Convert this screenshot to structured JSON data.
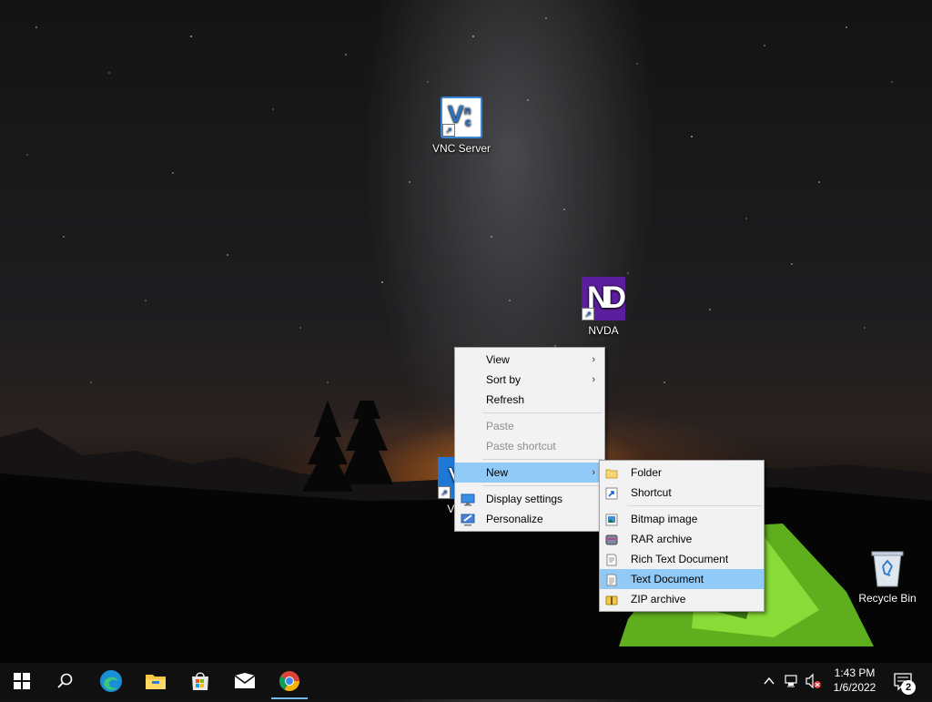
{
  "desktop": {
    "icons": {
      "vnc_server": {
        "label": "VNC Server",
        "icon": "vnc-icon"
      },
      "nvda": {
        "label": "NVDA",
        "icon": "nvda-icon"
      },
      "vnc_viewer": {
        "label": "VNC",
        "icon": "vnc-icon"
      },
      "recycle_bin": {
        "label": "Recycle Bin",
        "icon": "recycle-bin-icon"
      }
    }
  },
  "context_menu": {
    "view": "View",
    "sort_by": "Sort by",
    "refresh": "Refresh",
    "paste": "Paste",
    "paste_shortcut": "Paste shortcut",
    "new": "New",
    "display_settings": "Display settings",
    "personalize": "Personalize"
  },
  "new_submenu": {
    "folder": "Folder",
    "shortcut": "Shortcut",
    "bitmap_image": "Bitmap image",
    "rar_archive": "RAR archive",
    "rich_text_document": "Rich Text Document",
    "text_document": "Text Document",
    "zip_archive": "ZIP archive"
  },
  "taskbar": {
    "pinned": [
      "windows-start-icon",
      "search-icon",
      "edge-icon",
      "file-explorer-icon",
      "store-icon",
      "mail-icon",
      "chrome-icon"
    ],
    "clock": {
      "time": "1:43 PM",
      "date": "1/6/2022"
    },
    "notification_count": "2"
  },
  "colors": {
    "menu_highlight": "#91c9f7",
    "taskbar": "#101010",
    "tent": "#7fd12a"
  }
}
